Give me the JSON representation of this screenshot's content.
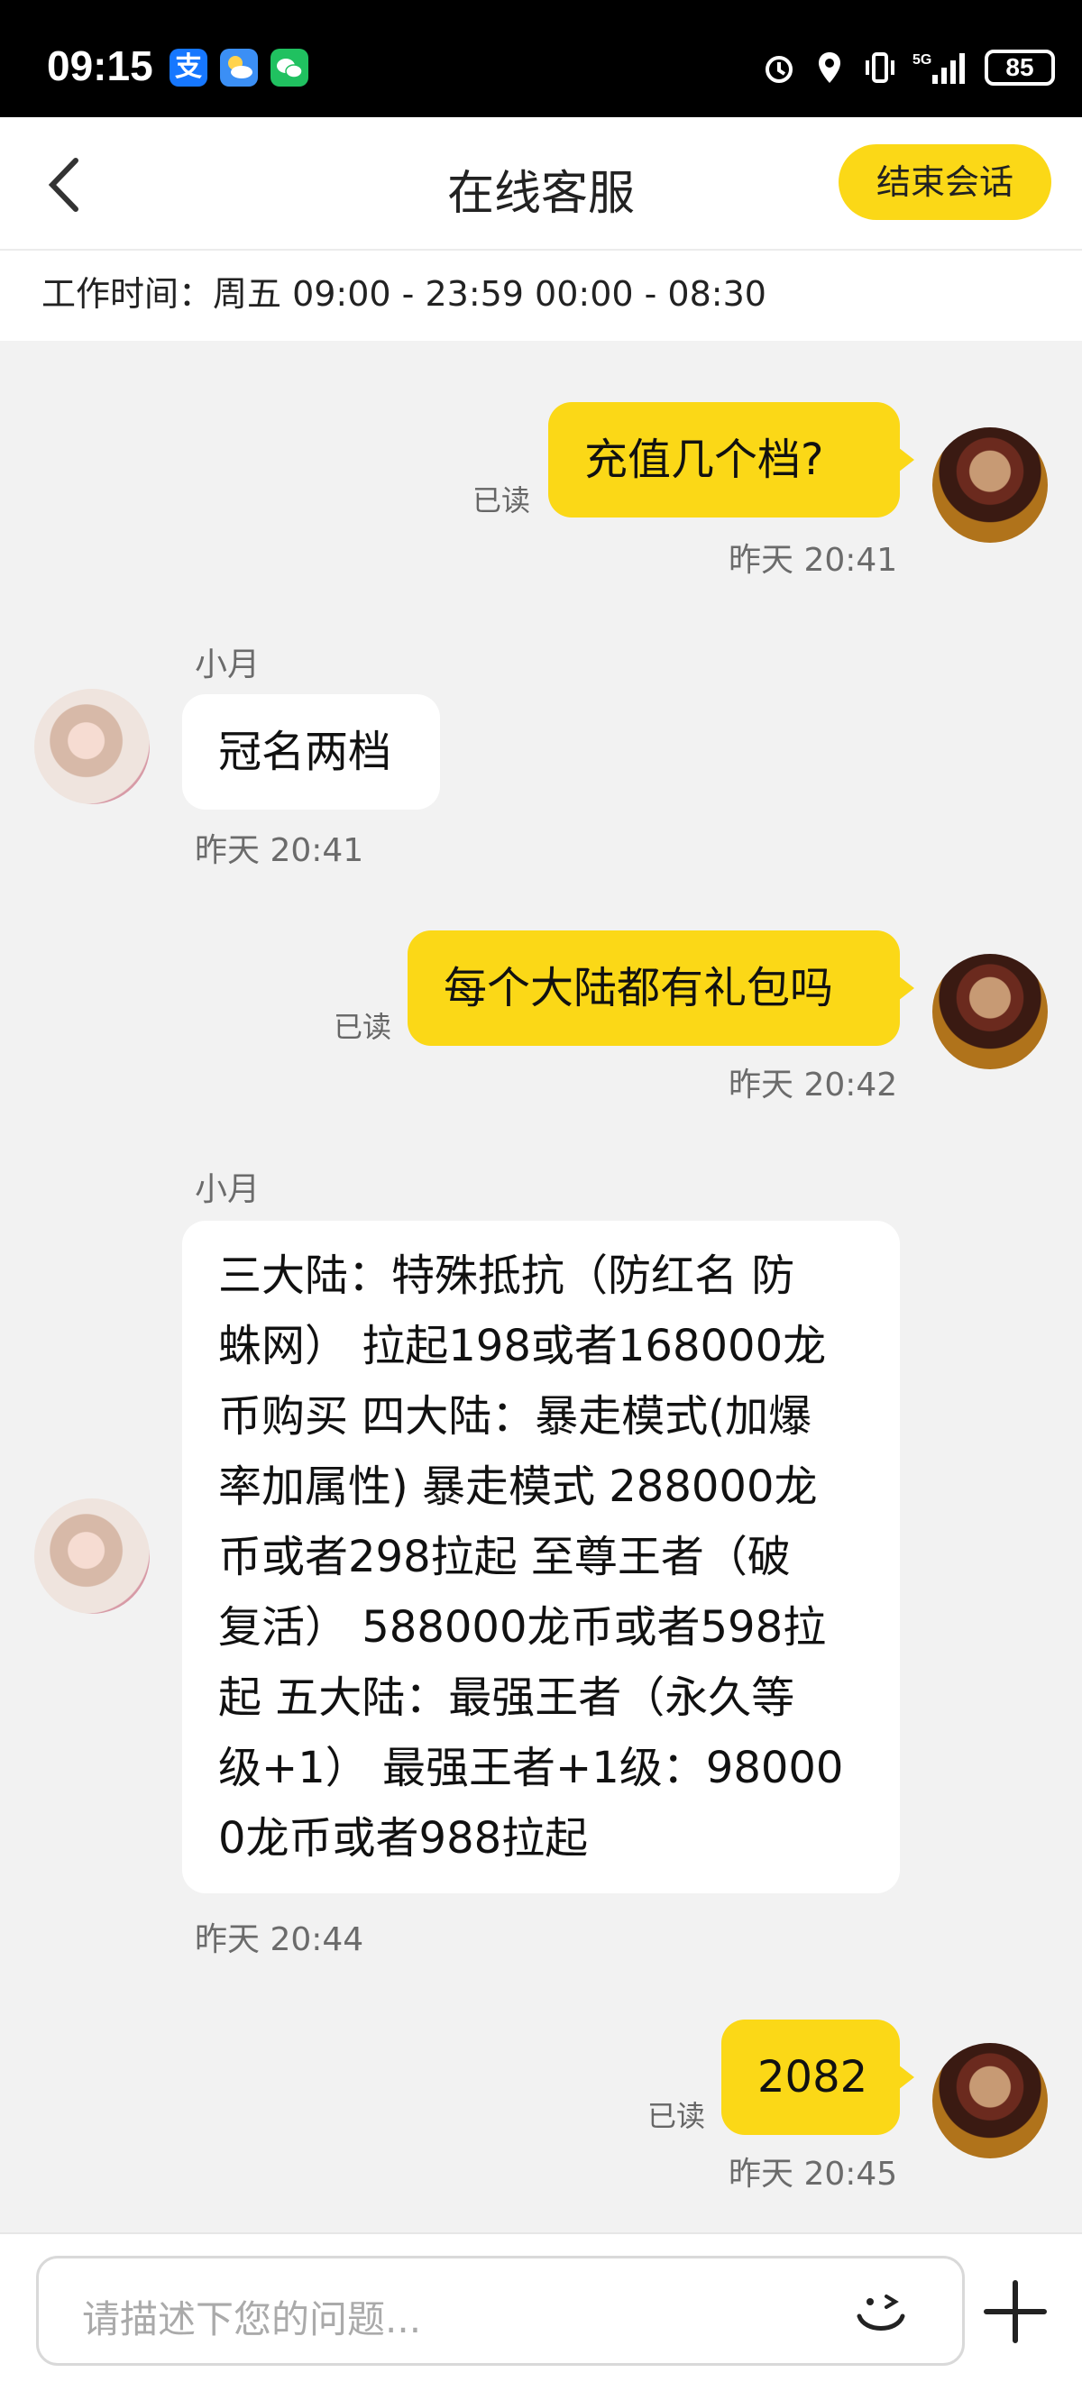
{
  "status_bar": {
    "time": "09:15",
    "notif_alipay": "支",
    "battery": "85"
  },
  "header": {
    "title": "在线客服",
    "end_button": "结束会话"
  },
  "hours": {
    "text": "工作时间：周五 09:00 - 23:59 00:00 - 08:30"
  },
  "messages": [
    {
      "sender": "me",
      "text": "充值几个档?",
      "read": "已读",
      "time": "昨天 20:41"
    },
    {
      "sender": "them",
      "name": "小月",
      "text": "冠名两档",
      "time": "昨天 20:41"
    },
    {
      "sender": "me",
      "text": "每个大陆都有礼包吗",
      "read": "已读",
      "time": "昨天 20:42"
    },
    {
      "sender": "them",
      "name": "小月",
      "lines": [
        "三大陆：特殊抵抗（防红名 防",
        "蛛网） 拉起198或者168000龙",
        "币购买 四大陆：暴走模式(加爆",
        "率加属性) 暴走模式 288000龙",
        "币或者298拉起 至尊王者（破",
        "复活） 588000龙币或者598拉",
        "起 五大陆：最强王者（永久等",
        "级+1） 最强王者+1级：98000",
        "0龙币或者988拉起"
      ],
      "time": "昨天 20:44"
    },
    {
      "sender": "me",
      "text": "2082",
      "read": "已读",
      "time": "昨天 20:45"
    }
  ],
  "input": {
    "placeholder": "请描述下您的问题..."
  },
  "colors": {
    "accent": "#fbd817",
    "background": "#f2f2f2"
  }
}
